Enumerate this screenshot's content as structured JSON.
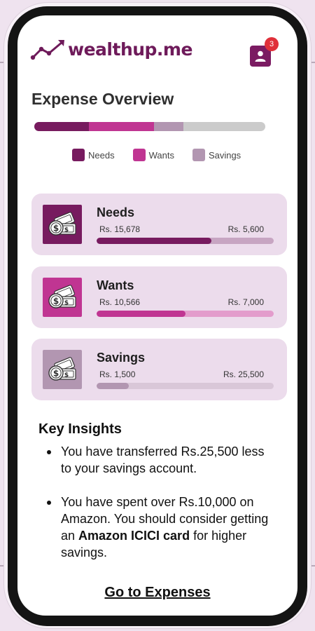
{
  "brand": {
    "name": "wealthup.me",
    "color": "#6e1a5a"
  },
  "header": {
    "notification_count": "3",
    "profile_icon": "user-icon"
  },
  "overview": {
    "title": "Expense Overview",
    "bar_shares": {
      "needs": 0.236,
      "wants": 0.282,
      "savings": 0.127,
      "remaining": 0.355
    },
    "legend": [
      {
        "label": "Needs",
        "color": "#771b5f"
      },
      {
        "label": "Wants",
        "color": "#c03592"
      },
      {
        "label": "Savings",
        "color": "#b296b1"
      }
    ]
  },
  "categories": [
    {
      "name": "Needs",
      "spent": "Rs. 15,678",
      "target": "Rs. 5,600",
      "progress": 0.65,
      "color": "#771b5f",
      "track_color": "#c7a5c2",
      "icon": "cash-icon"
    },
    {
      "name": "Wants",
      "spent": "Rs. 10,566",
      "target": "Rs. 7,000",
      "progress": 0.5,
      "color": "#c03592",
      "track_color": "#e39ccc",
      "icon": "cash-icon"
    },
    {
      "name": "Savings",
      "spent": "Rs. 1,500",
      "target": "Rs. 25,500",
      "progress": 0.18,
      "color": "#b296b1",
      "track_color": "#d9c7d8",
      "icon": "cash-icon"
    }
  ],
  "insights": {
    "title": "Key Insights",
    "items": [
      {
        "text": "You have transferred Rs.25,500 less to your savings account."
      },
      {
        "pre": "You have spent over Rs.10,000 on Amazon. You should consider getting an ",
        "bold": "Amazon ICICI card",
        "post": " for higher savings."
      }
    ]
  },
  "cta": {
    "label": "Go to Expenses"
  }
}
